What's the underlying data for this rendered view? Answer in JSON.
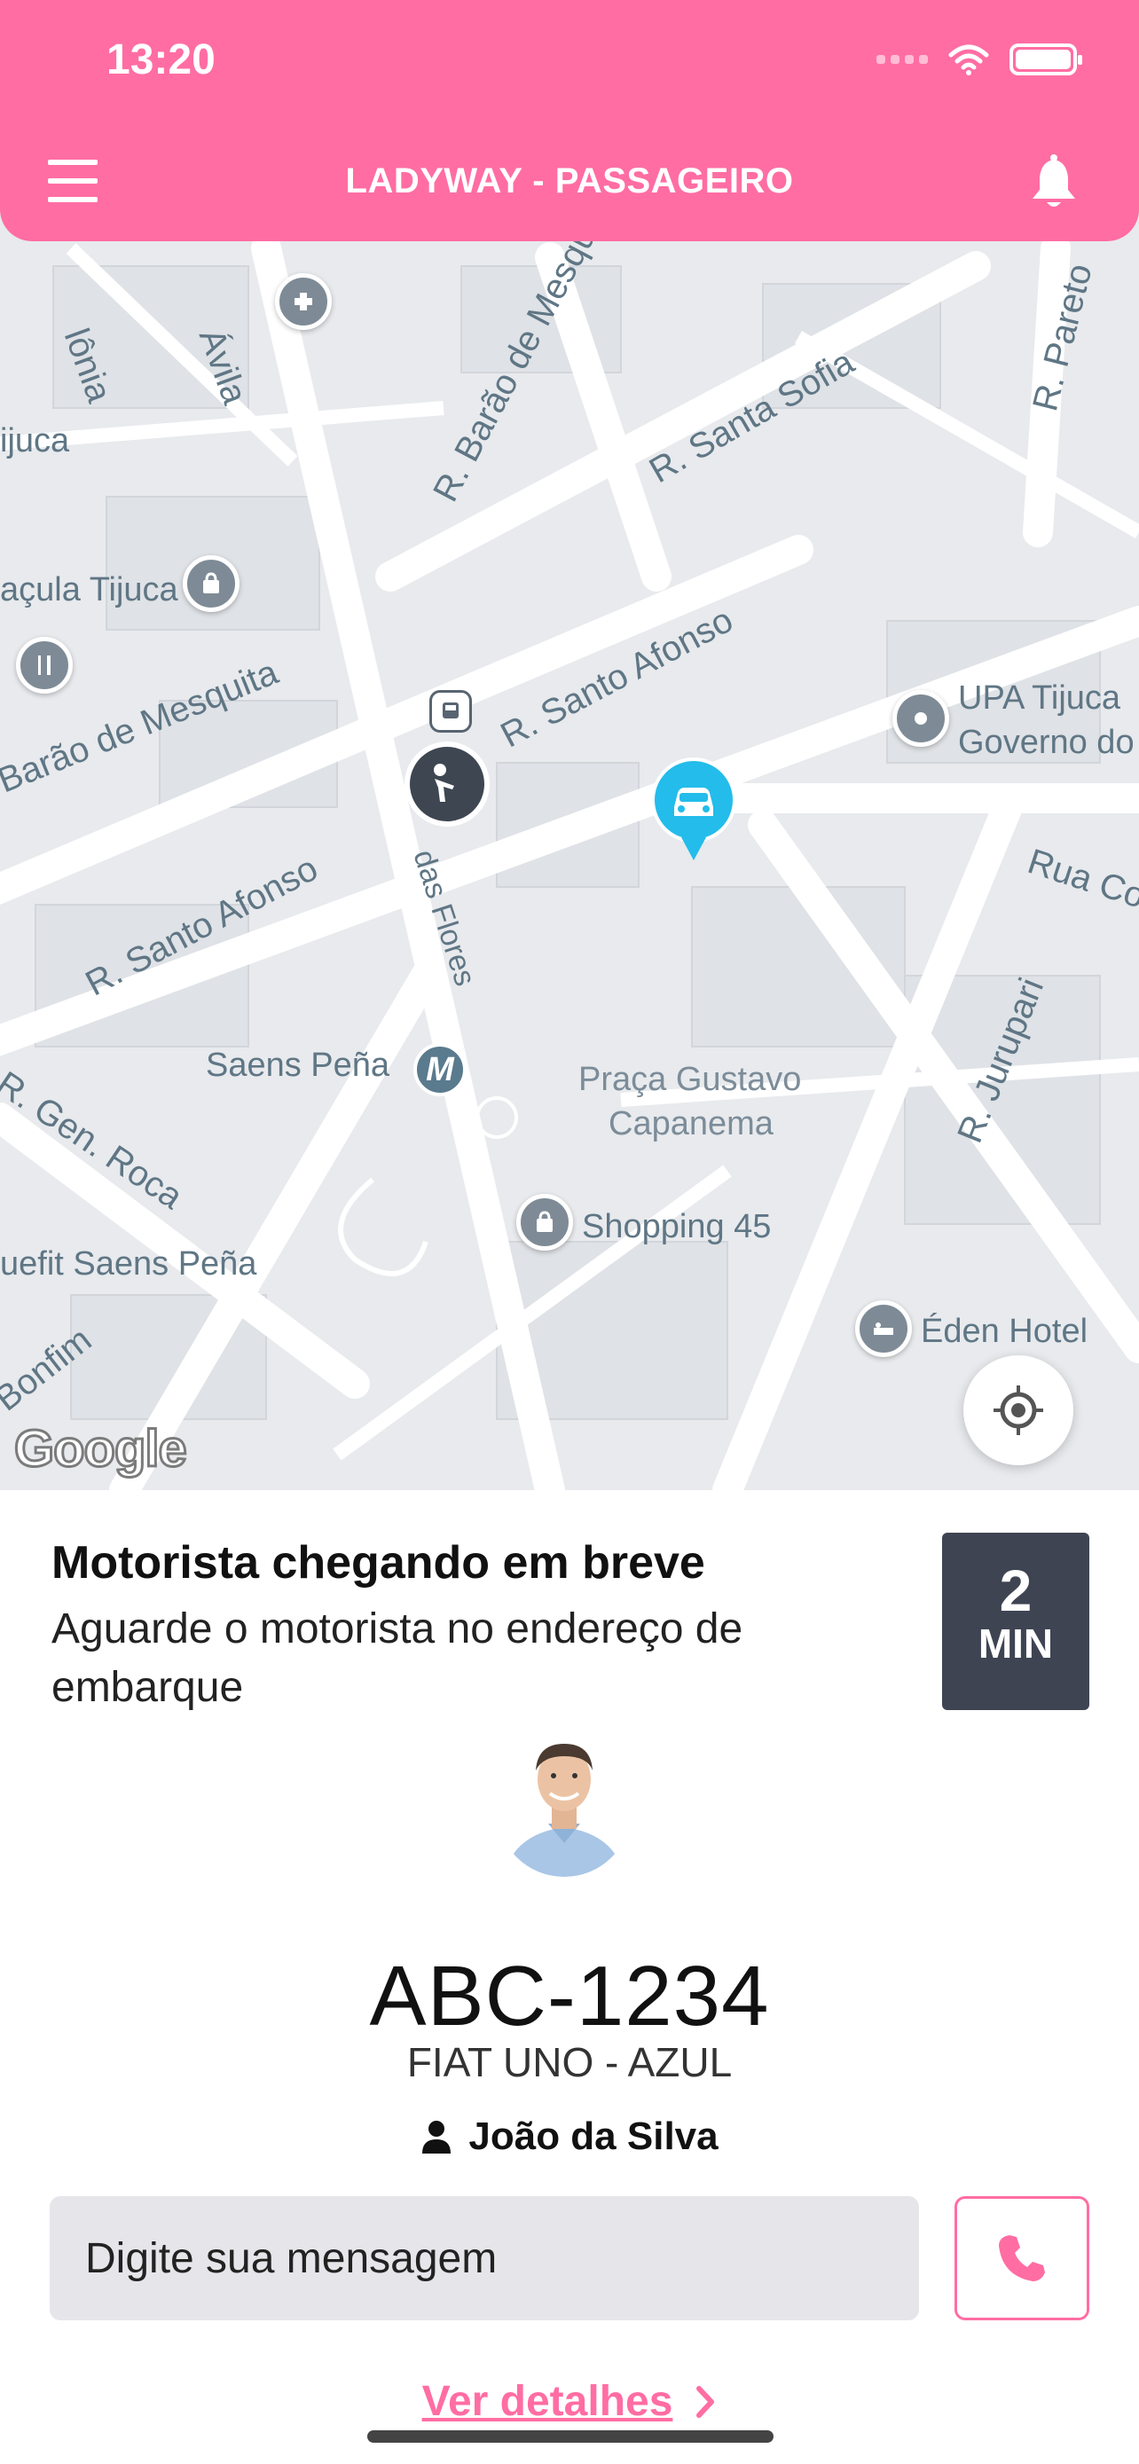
{
  "status_bar": {
    "time": "13:20"
  },
  "header": {
    "title": "LADYWAY - PASSAGEIRO",
    "menu_icon": "menu-icon",
    "bell_icon": "bell-icon"
  },
  "colors": {
    "brand": "#FF6DA3",
    "eta_bg": "#3E4452",
    "car_pin": "#23BCEB",
    "input_bg": "#E6E6EA"
  },
  "map": {
    "streets": [
      "R. Barão de Mesquita",
      "R. Santa Sofia",
      "R. Santo Afonso",
      "R. Santo Afonso",
      "Barão de Mesquita",
      "R. Gen. Roca",
      "R. Jurupari",
      "Rua Co",
      "R. Pareto",
      "das Flores",
      "Bonfim",
      "Ávila",
      "lônia"
    ],
    "places": [
      "UPA Tijuca",
      "Governo do",
      "Saens Peña",
      "Praça Gustavo",
      "Capanema",
      "Shopping 45",
      "Éden Hotel",
      "uefit Saens Peña",
      "açula Tijuca",
      "ijuca"
    ],
    "logo": "Google"
  },
  "trip": {
    "title": "Motorista chegando em breve",
    "subtitle": "Aguarde o motorista no endereço de embarque",
    "eta_value": "2",
    "eta_unit": "MIN",
    "plate": "ABC-1234",
    "car": "FIAT UNO - AZUL",
    "driver_name": "João da Silva"
  },
  "message": {
    "placeholder": "Digite sua mensagem"
  },
  "actions": {
    "details_label": "Ver detalhes"
  }
}
